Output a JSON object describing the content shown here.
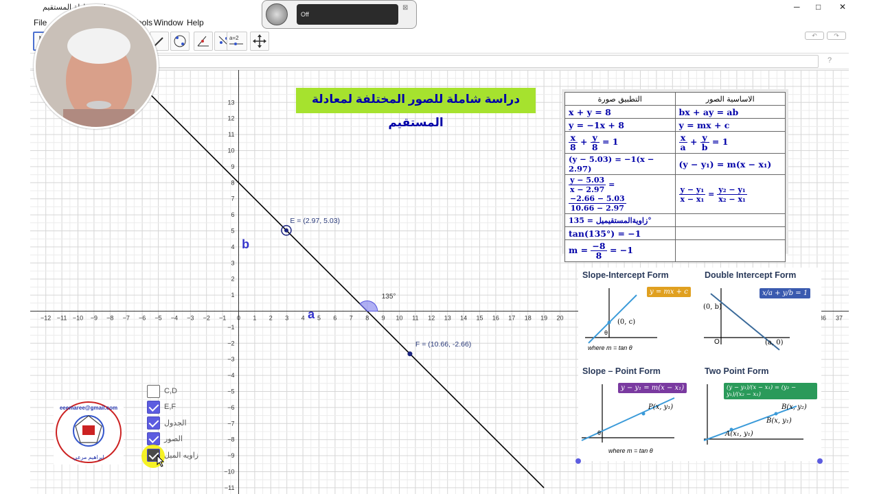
{
  "window": {
    "title": "معادلة المستقيم.ggb",
    "min": "─",
    "max": "□",
    "close": "✕"
  },
  "menu": [
    "File",
    "Tools",
    "Window",
    "Help"
  ],
  "recorder": {
    "status": "Off"
  },
  "toolbar": {
    "undo": "↶",
    "redo": "↷",
    "tool_tip": "a=2",
    "help": "?"
  },
  "headline": "دراسة شاملة للصور المختلفة لمعادلة المستقيم",
  "table": {
    "head_left": "التطبيق صورة",
    "head_right": "الاساسية الصور",
    "r1l": "x + y = 8",
    "r1r": "bx + ay = ab",
    "r2l": "y = −1x + 8",
    "r2r": "y = mx + c",
    "r3l_a": "x",
    "r3l_b": "8",
    "r3l_c": "y",
    "r3l_d": "8",
    "r3l_e": "= 1",
    "r3r_a": "x",
    "r3r_b": "a",
    "r3r_c": "y",
    "r3r_d": "b",
    "r3r_e": "= 1",
    "r4l": "(y − 5.03) = −1(x − 2.97)",
    "r4r": "(y − y₁) = m(x − x₁)",
    "r5l_a": "y − 5.03",
    "r5l_b": "x − 2.97",
    "r5l_c": "−2.66 − 5.03",
    "r5l_d": "10.66 − 2.97",
    "r5r_a": "y − y₁",
    "r5r_b": "x − x₁",
    "r5r_c": "y₂ − y₁",
    "r5r_d": "x₂ − x₁",
    "r6l": "زاويةالمستقيميل = 135°",
    "r7l": "tan(135°) = −1",
    "r8l_a": "m =",
    "r8l_b": "−8",
    "r8l_c": "8",
    "r8l_d": "= −1"
  },
  "graph": {
    "xticks": [
      -12,
      -11,
      -10,
      -9,
      -8,
      -7,
      -6,
      -5,
      -4,
      -3,
      -2,
      -1,
      0,
      1,
      2,
      3,
      4,
      5,
      6,
      7,
      8,
      9,
      10,
      11,
      12,
      13,
      14,
      15,
      16,
      17,
      18,
      19,
      20,
      36,
      37
    ],
    "point_E": "E = (2.97, 5.03)",
    "point_F": "F = (10.66, -2.66)",
    "angle": "135°",
    "label_a": "a",
    "label_b": "b"
  },
  "cards": {
    "c1": {
      "title": "Slope-Intercept Form",
      "eq": "y = mx + c",
      "pt": "(0, c)",
      "theta": "θ",
      "foot": "where m = tan θ"
    },
    "c2": {
      "title": "Double Intercept Form",
      "eq": "x/a + y/b = 1",
      "p1": "(0, b)",
      "p2": "(a, 0)",
      "o": "O"
    },
    "c3": {
      "title": "Slope – Point Form",
      "eq": "y − y₁ = m(x − x₁)",
      "pt": "P(x, y₁)",
      "theta": "θ",
      "foot": "where m = tan θ"
    },
    "c4": {
      "title": "Two Point Form",
      "eq": "(y − y₁)/(x − x₁) = (y₂ − y₁)/(x₂ − x₁)",
      "p1": "A(x₁, y₁)",
      "p2": "B(x, y₂)",
      "p3": "B(x, y₁)"
    }
  },
  "checkboxes": [
    {
      "label": "C,D",
      "checked": false
    },
    {
      "label": "E,F",
      "checked": true
    },
    {
      "label": "الجدول",
      "checked": true
    },
    {
      "label": "الصور",
      "checked": true
    },
    {
      "label": "زاويه الميل",
      "checked": true
    }
  ],
  "logo": {
    "email": "eeemaree@gmail.com",
    "name": "ابراهيم مرعي"
  }
}
